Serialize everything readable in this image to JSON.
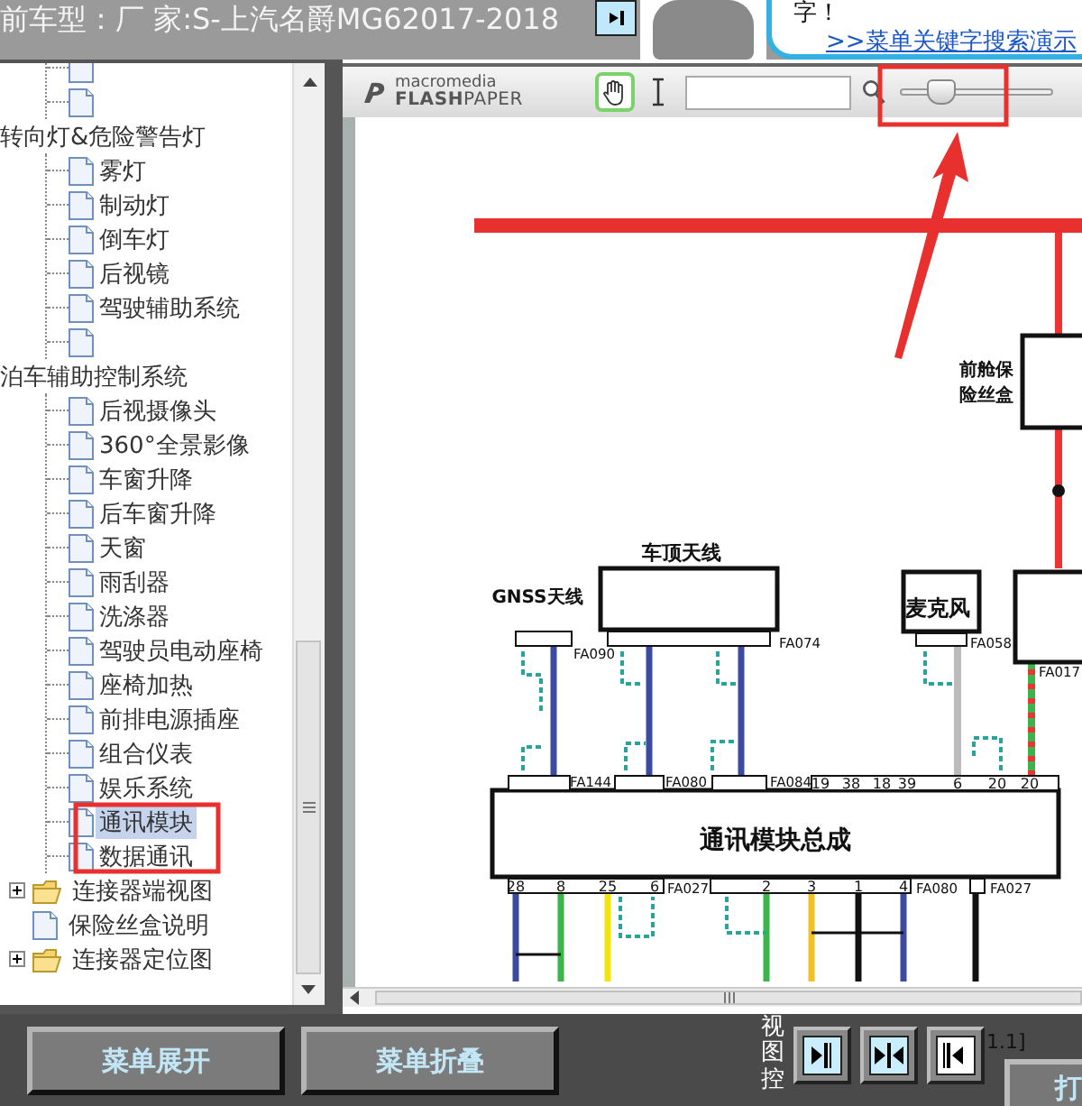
{
  "top_bar": {
    "title": "前车型：厂 家:S-上汽名爵MG62017-2018",
    "bubble_text": "字！",
    "demo_link": ">>菜单关键字搜索演示"
  },
  "tree": {
    "items": [
      {
        "kind": "group",
        "children": [
          {
            "kind": "doc"
          },
          {
            "kind": "doc"
          }
        ]
      },
      {
        "kind": "group",
        "label": "转向灯&危险警告灯",
        "children": [
          {
            "kind": "doc",
            "label": "雾灯",
            "selected": false
          },
          {
            "kind": "doc",
            "label": "制动灯",
            "selected": false
          },
          {
            "kind": "doc",
            "label": "倒车灯",
            "selected": false
          },
          {
            "kind": "doc",
            "label": "后视镜",
            "selected": false
          },
          {
            "kind": "doc",
            "label": "驾驶辅助系统",
            "selected": false
          },
          {
            "kind": "doc"
          }
        ]
      },
      {
        "kind": "group",
        "label": "泊车辅助控制系统",
        "children": [
          {
            "kind": "doc",
            "label": "后视摄像头",
            "selected": false
          },
          {
            "kind": "doc",
            "label": "360°全景影像",
            "selected": false
          },
          {
            "kind": "doc",
            "label": "车窗升降",
            "selected": false
          },
          {
            "kind": "doc",
            "label": "后车窗升降",
            "selected": false
          },
          {
            "kind": "doc",
            "label": "天窗",
            "selected": false
          },
          {
            "kind": "doc",
            "label": "雨刮器",
            "selected": false
          },
          {
            "kind": "doc",
            "label": "洗涤器",
            "selected": false
          },
          {
            "kind": "doc",
            "label": "驾驶员电动座椅",
            "selected": false
          },
          {
            "kind": "doc",
            "label": "座椅加热",
            "selected": false
          },
          {
            "kind": "doc",
            "label": "前排电源插座",
            "selected": false
          },
          {
            "kind": "doc",
            "label": "组合仪表",
            "selected": false
          },
          {
            "kind": "doc",
            "label": "娱乐系统",
            "selected": false
          },
          {
            "kind": "doc",
            "label": "通讯模块",
            "selected": true
          },
          {
            "kind": "doc",
            "label": "数据通讯",
            "selected": false
          }
        ]
      },
      {
        "kind": "folder",
        "label": "连接器端视图",
        "expanded": false
      },
      {
        "kind": "doc",
        "label": "保险丝盒说明",
        "selected": false
      },
      {
        "kind": "folder",
        "label": "连接器定位图",
        "expanded": false
      }
    ]
  },
  "viewer": {
    "logo_top": "macromedia",
    "logo_bottom": "**FLASH**PAPER",
    "zoom": {
      "level": 0.2
    }
  },
  "diagram": {
    "components": [
      "车顶天线",
      "GNSS天线",
      "麦克风",
      "前舱保",
      "险丝盒",
      "通讯模块总成"
    ],
    "connectors": [
      "FA090",
      "FA074",
      "FA058",
      "FA017",
      "FA144",
      "FA080",
      "FA084",
      "FA027",
      "FA080",
      "FA027"
    ],
    "top_pins": [
      "19",
      "38",
      "18",
      "39",
      "6",
      "20",
      "20"
    ],
    "bottom_pins": [
      "28",
      "8",
      "25",
      "6",
      "2",
      "3",
      "1",
      "4"
    ]
  },
  "bottom_bar": {
    "buttons": [
      "菜单展开",
      "菜单折叠"
    ],
    "view_label": "视图控",
    "view_buttons": [
      {
        "kind": "fit-right",
        "active": true
      },
      {
        "kind": "fit-both",
        "active": true
      },
      {
        "kind": "fit-left",
        "active": false
      }
    ],
    "page_indicator": "1.1]",
    "print_button": "打"
  }
}
